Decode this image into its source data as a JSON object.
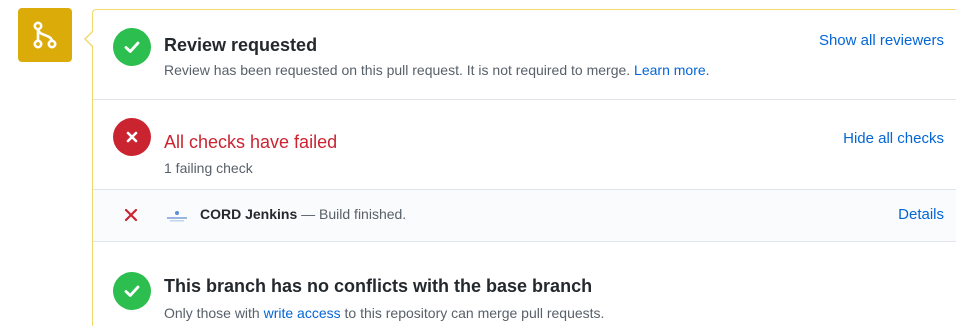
{
  "review": {
    "title": "Review requested",
    "description": "Review has been requested on this pull request. It is not required to merge.",
    "learn_more": "Learn more.",
    "show_reviewers": "Show all reviewers"
  },
  "checks": {
    "title": "All checks have failed",
    "summary": "1 failing check",
    "hide_checks": "Hide all checks",
    "items": [
      {
        "context": "CORD Jenkins",
        "separator": " — ",
        "description": "Build finished.",
        "details": "Details"
      }
    ]
  },
  "branch": {
    "title": "This branch has no conflicts with the base branch",
    "desc_prefix": "Only those with ",
    "write_access": "write access",
    "desc_suffix": " to this repository can merge pull requests."
  },
  "colors": {
    "badge": "#dbab09",
    "success": "#2cbe4e",
    "fail": "#cb2431",
    "link": "#0366d6"
  },
  "icons": {
    "badge": "git-pull-request-icon",
    "review_status": "check-circle-icon",
    "checks_status": "x-circle-icon",
    "check_item_status": "x-icon",
    "check_item_logo": "jenkins-logo-icon",
    "branch_status": "check-circle-icon"
  }
}
